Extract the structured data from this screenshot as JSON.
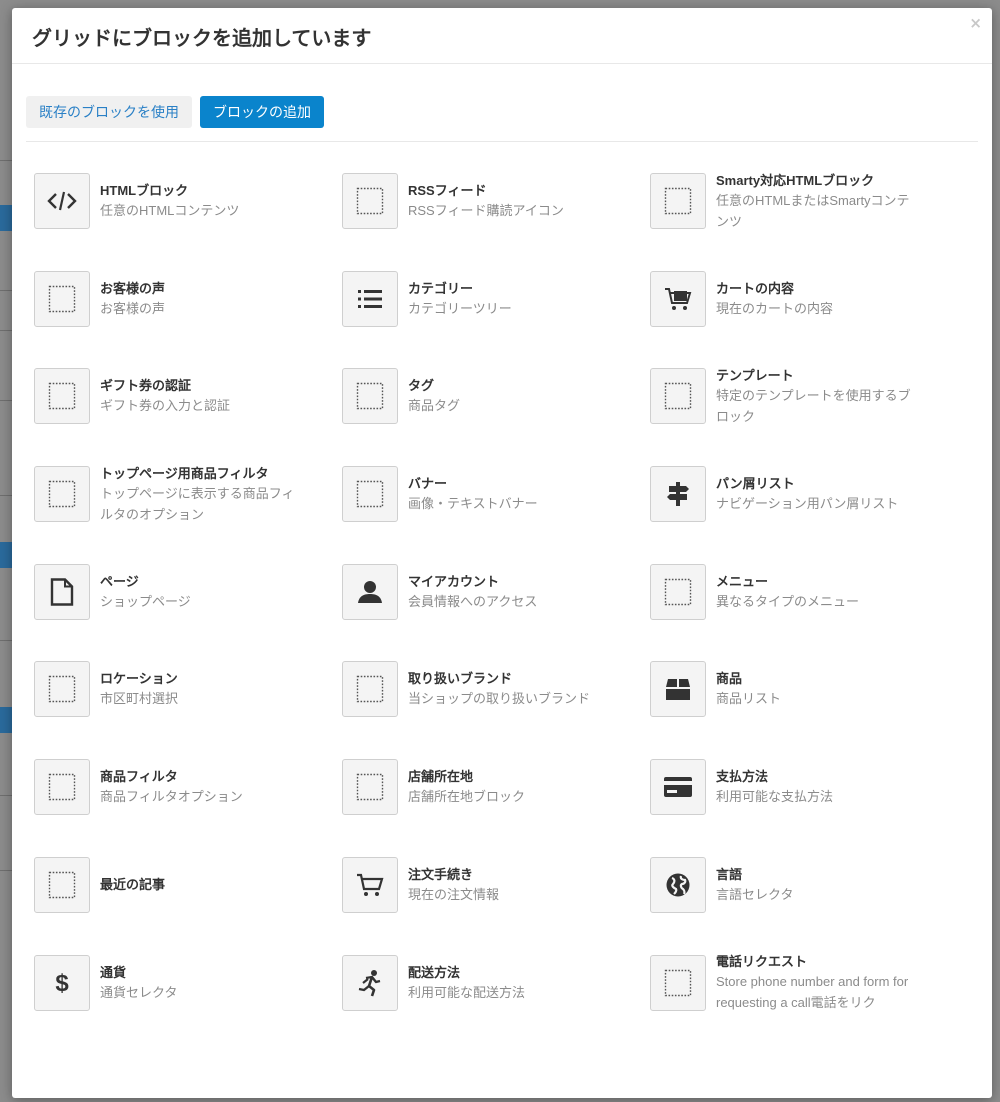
{
  "modal": {
    "title": "グリッドにブロックを追加しています",
    "close_label": "×"
  },
  "tabs": [
    {
      "label": "既存のブロックを使用",
      "active": false
    },
    {
      "label": "ブロックの追加",
      "active": true
    }
  ],
  "blocks": [
    {
      "name": "HTMLブロック",
      "desc": "任意のHTMLコンテンツ",
      "icon": "code-icon"
    },
    {
      "name": "RSSフィード",
      "desc": "RSSフィード購読アイコン",
      "icon": "placeholder-icon"
    },
    {
      "name": "Smarty対応HTMLブロック",
      "desc": "任意のHTMLまたはSmartyコンテンツ",
      "icon": "placeholder-icon"
    },
    {
      "name": "お客様の声",
      "desc": "お客様の声",
      "icon": "placeholder-icon"
    },
    {
      "name": "カテゴリー",
      "desc": "カテゴリーツリー",
      "icon": "list-icon"
    },
    {
      "name": "カートの内容",
      "desc": "現在のカートの内容",
      "icon": "cart-full-icon"
    },
    {
      "name": "ギフト券の認証",
      "desc": "ギフト券の入力と認証",
      "icon": "placeholder-icon"
    },
    {
      "name": "タグ",
      "desc": "商品タグ",
      "icon": "placeholder-icon"
    },
    {
      "name": "テンプレート",
      "desc": "特定のテンプレートを使用するブロック",
      "icon": "placeholder-icon"
    },
    {
      "name": "トップページ用商品フィルタ",
      "desc": "トップページに表示する商品フィルタのオプション",
      "icon": "placeholder-icon"
    },
    {
      "name": "バナー",
      "desc": "画像・テキストバナー",
      "icon": "placeholder-icon"
    },
    {
      "name": "パン屑リスト",
      "desc": "ナビゲーション用パン屑リスト",
      "icon": "signpost-icon"
    },
    {
      "name": "ページ",
      "desc": "ショップページ",
      "icon": "page-icon"
    },
    {
      "name": "マイアカウント",
      "desc": "会員情報へのアクセス",
      "icon": "user-icon"
    },
    {
      "name": "メニュー",
      "desc": "異なるタイプのメニュー",
      "icon": "placeholder-icon"
    },
    {
      "name": "ロケーション",
      "desc": "市区町村選択",
      "icon": "placeholder-icon"
    },
    {
      "name": "取り扱いブランド",
      "desc": "当ショップの取り扱いブランド",
      "icon": "placeholder-icon"
    },
    {
      "name": "商品",
      "desc": "商品リスト",
      "icon": "box-icon"
    },
    {
      "name": "商品フィルタ",
      "desc": "商品フィルタオプション",
      "icon": "placeholder-icon"
    },
    {
      "name": "店舗所在地",
      "desc": "店舗所在地ブロック",
      "icon": "placeholder-icon"
    },
    {
      "name": "支払方法",
      "desc": "利用可能な支払方法",
      "icon": "credit-card-icon"
    },
    {
      "name": "最近の記事",
      "desc": "",
      "icon": "placeholder-icon"
    },
    {
      "name": "注文手続き",
      "desc": "現在の注文情報",
      "icon": "cart-icon"
    },
    {
      "name": "言語",
      "desc": "言語セレクタ",
      "icon": "globe-icon"
    },
    {
      "name": "通貨",
      "desc": "通貨セレクタ",
      "icon": "dollar-icon"
    },
    {
      "name": "配送方法",
      "desc": "利用可能な配送方法",
      "icon": "runner-icon"
    },
    {
      "name": "電話リクエスト",
      "desc": "Store phone number and form for requesting a call電話をリク",
      "icon": "placeholder-icon"
    }
  ],
  "colors": {
    "accent": "#0a84cc",
    "link": "#2a80c6",
    "title": "#333333",
    "muted": "#8b8b8b"
  }
}
